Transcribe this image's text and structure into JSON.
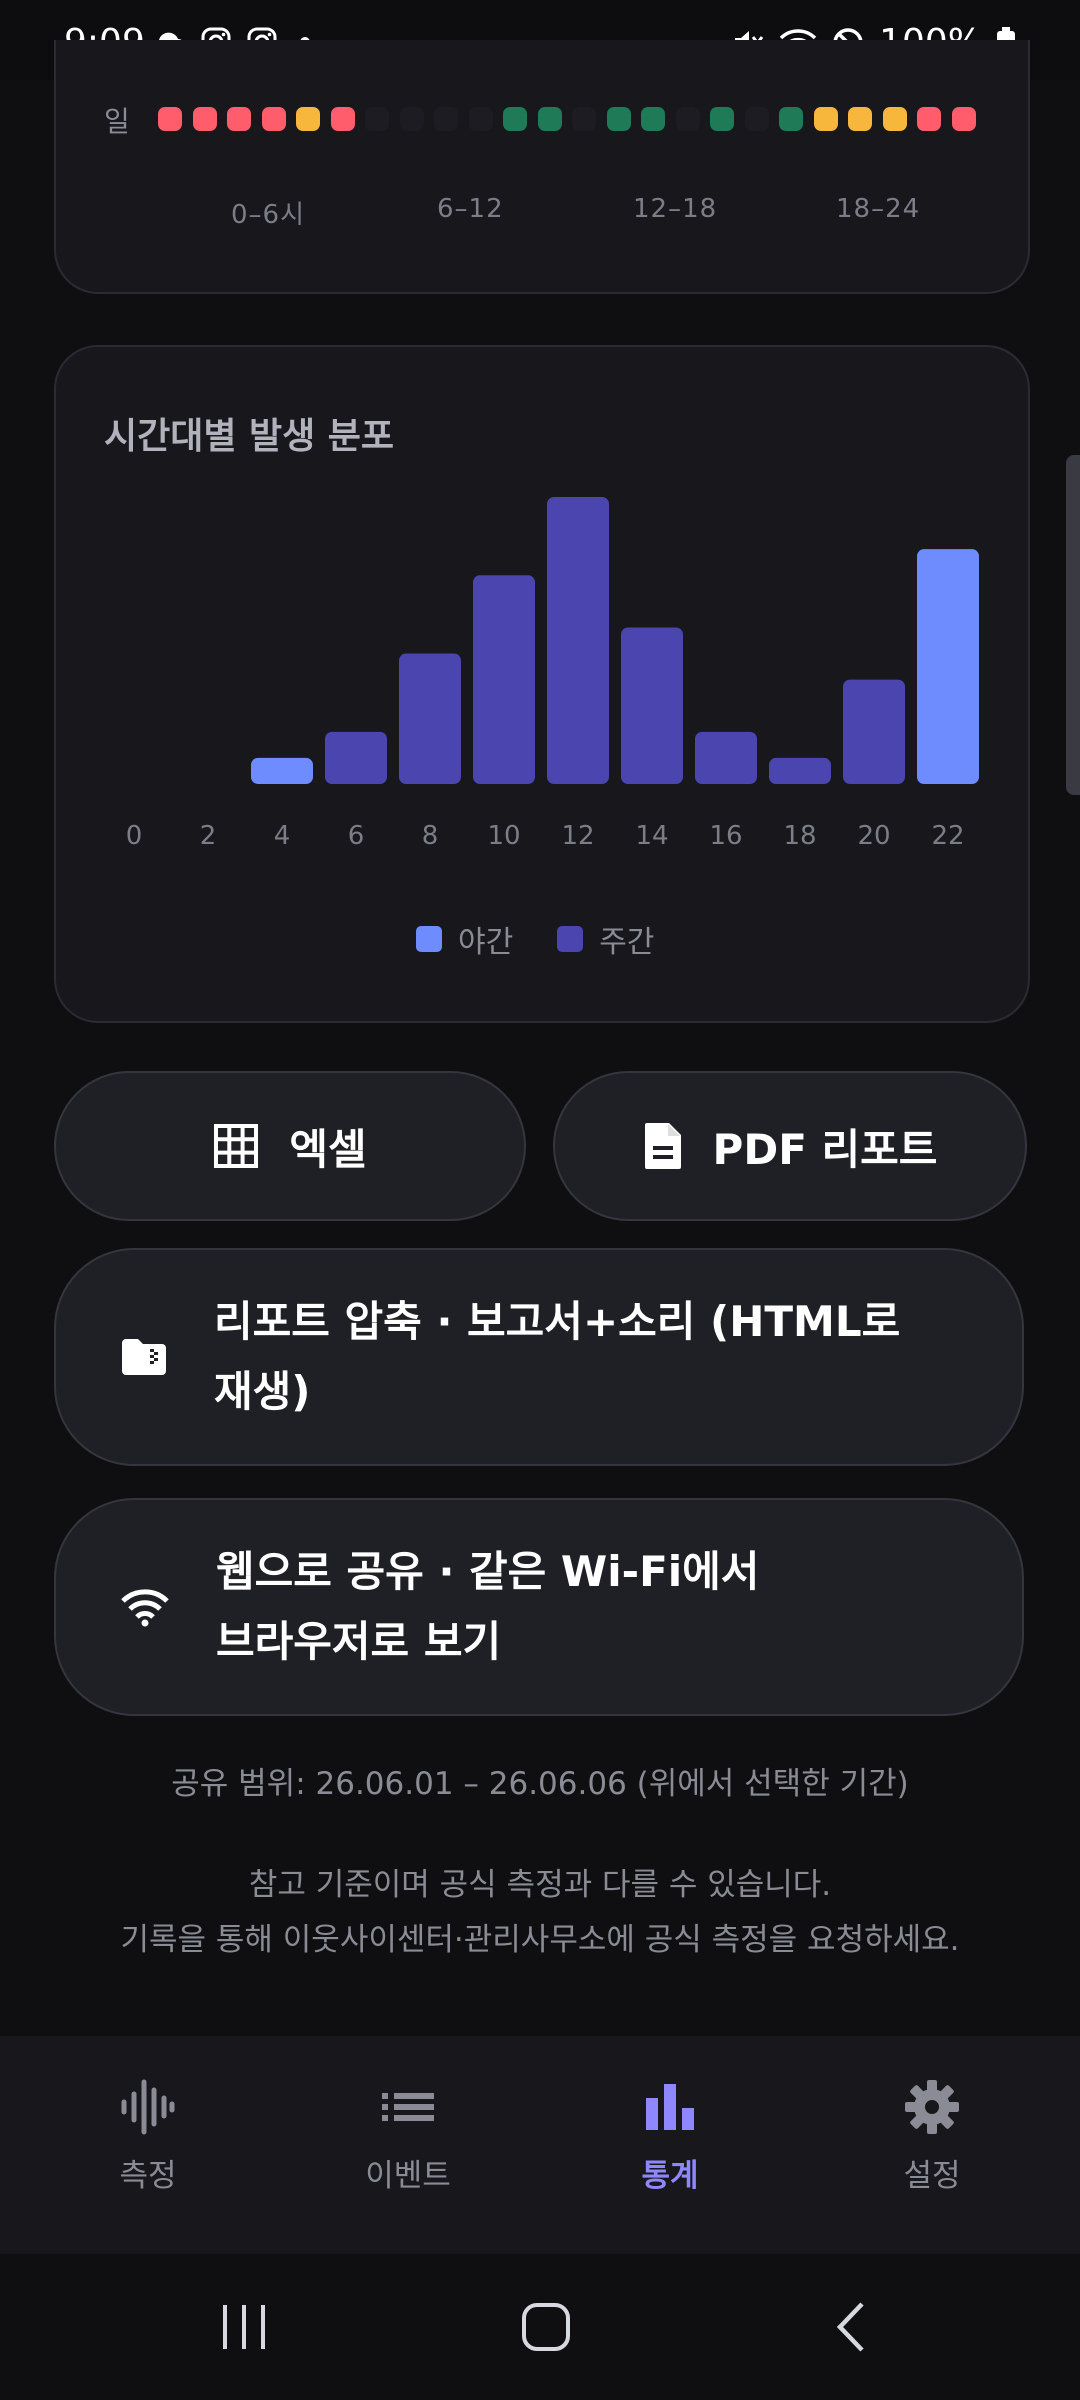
{
  "status_bar": {
    "time": "9:09",
    "battery": "100%",
    "left_icons": [
      "cloud-icon",
      "instagram-icon",
      "instagram-icon",
      "dot-icon"
    ],
    "right_icons": [
      "mute-icon",
      "wifi-icon",
      "dnd-icon",
      "battery-icon"
    ]
  },
  "heatmap": {
    "row_label": "일",
    "dot_colors": {
      "red": "#ff5c6c",
      "yellow": "#f6b73c",
      "green": "#1f7a57",
      "empty": "#1c1c22"
    },
    "row_cells": [
      "red",
      "red",
      "red",
      "red",
      "yellow",
      "red",
      "empty",
      "empty",
      "empty",
      "empty",
      "green",
      "green",
      "empty",
      "green",
      "green",
      "empty",
      "green",
      "empty",
      "green",
      "yellow",
      "yellow",
      "yellow",
      "red",
      "red"
    ],
    "hour_labels": [
      "0–6시",
      "6–12",
      "12–18",
      "18–24"
    ]
  },
  "chart": {
    "title": "시간대별 발생 분포",
    "legend": [
      {
        "label": "야간",
        "color": "#6f8cff"
      },
      {
        "label": "주간",
        "color": "#4b45b0"
      }
    ]
  },
  "chart_data": {
    "type": "bar",
    "title": "시간대별 발생 분포",
    "categories": [
      "0",
      "2",
      "4",
      "6",
      "8",
      "10",
      "12",
      "14",
      "16",
      "18",
      "20",
      "22"
    ],
    "values": [
      0,
      0,
      1,
      2,
      5,
      8,
      11,
      6,
      2,
      1,
      4,
      9
    ],
    "series_by_bar": [
      "야간",
      "야간",
      "야간",
      "주간",
      "주간",
      "주간",
      "주간",
      "주간",
      "주간",
      "주간",
      "주간",
      "야간"
    ],
    "ylim": [
      0,
      11
    ],
    "grid": false,
    "legend_position": "bottom-center"
  },
  "buttons": {
    "excel": "엑셀",
    "pdf": "PDF 리포트",
    "zip_line1": "리포트 압축 · 보고서+소리 (HTML로",
    "zip_line2": "재생)",
    "web_line1": "웹으로 공유 · 같은 Wi-Fi에서",
    "web_line2": "브라우저로 보기"
  },
  "share_range": "공유 범위: 26.06.01 – 26.06.06 (위에서 선택한 기간)",
  "notice": {
    "line1": "참고 기준이며 공식 측정과 다를 수 있습니다.",
    "line2": "기록을 통해 이웃사이센터·관리사무소에 공식 측정을 요청하세요."
  },
  "nav": {
    "items": [
      {
        "label": "측정",
        "icon": "waveform-icon"
      },
      {
        "label": "이벤트",
        "icon": "list-icon"
      },
      {
        "label": "통계",
        "icon": "bar-chart-icon"
      },
      {
        "label": "설정",
        "icon": "gear-icon"
      }
    ],
    "active_index": 2,
    "active_color": "#8f87ff",
    "inactive_color": "#8b8b96"
  },
  "system_nav": [
    "recents-icon",
    "home-icon",
    "back-icon"
  ]
}
